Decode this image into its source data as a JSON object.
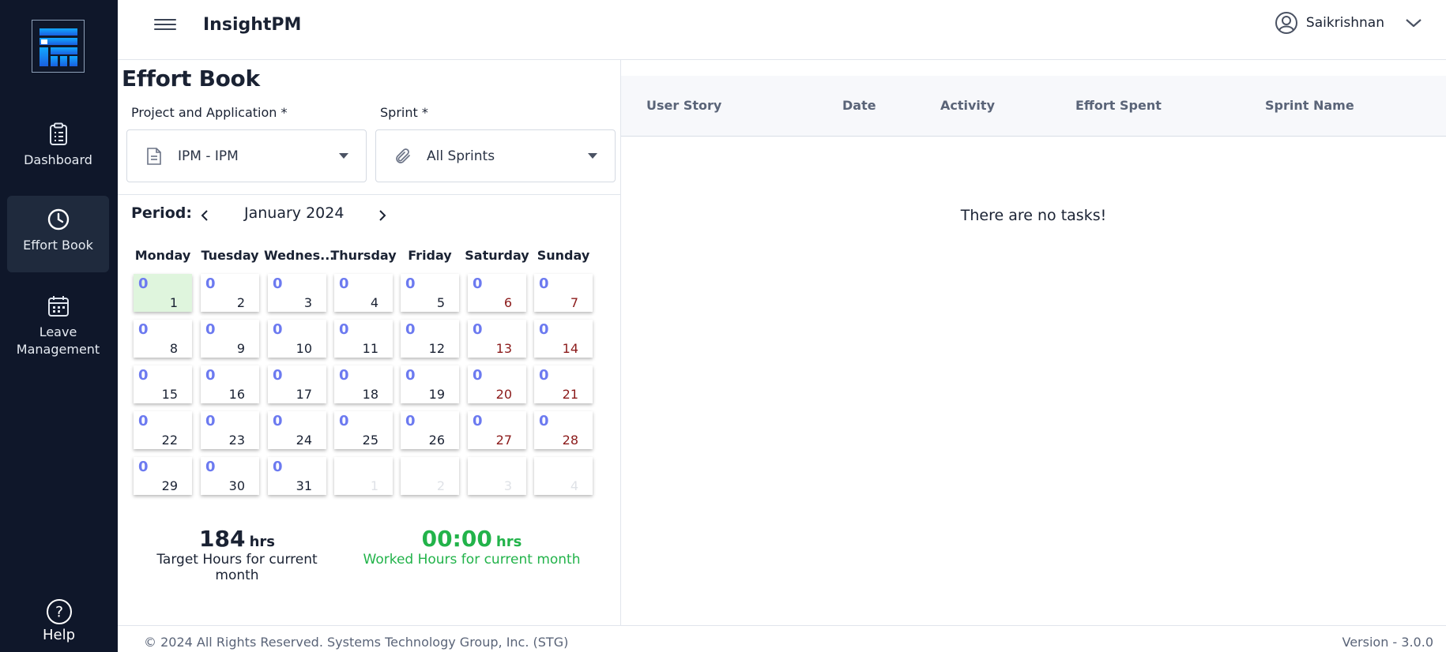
{
  "app": {
    "title": "InsightPM"
  },
  "user": {
    "name": "Saikrishnan"
  },
  "sidebar": {
    "items": [
      {
        "label": "Dashboard",
        "icon": "clipboard-icon"
      },
      {
        "label": "Effort Book",
        "icon": "clock-icon",
        "active": true
      },
      {
        "label": "Leave Management",
        "icon": "calendar-icon"
      }
    ],
    "help_label": "Help"
  },
  "effort_book": {
    "title": "Effort Book",
    "project": {
      "label": "Project and Application *",
      "value": "IPM - IPM"
    },
    "sprint": {
      "label": "Sprint *",
      "value": "All Sprints"
    },
    "period": {
      "label": "Period:",
      "month": "January 2024"
    },
    "weekdays": [
      "Monday",
      "Tuesday",
      "Wednes...",
      "Thursday",
      "Friday",
      "Saturday",
      "Sunday"
    ],
    "days": [
      {
        "hours": "0",
        "day": "1"
      },
      {
        "hours": "0",
        "day": "2"
      },
      {
        "hours": "0",
        "day": "3"
      },
      {
        "hours": "0",
        "day": "4"
      },
      {
        "hours": "0",
        "day": "5"
      },
      {
        "hours": "0",
        "day": "6"
      },
      {
        "hours": "0",
        "day": "7"
      },
      {
        "hours": "0",
        "day": "8"
      },
      {
        "hours": "0",
        "day": "9"
      },
      {
        "hours": "0",
        "day": "10"
      },
      {
        "hours": "0",
        "day": "11"
      },
      {
        "hours": "0",
        "day": "12"
      },
      {
        "hours": "0",
        "day": "13"
      },
      {
        "hours": "0",
        "day": "14"
      },
      {
        "hours": "0",
        "day": "15"
      },
      {
        "hours": "0",
        "day": "16"
      },
      {
        "hours": "0",
        "day": "17"
      },
      {
        "hours": "0",
        "day": "18"
      },
      {
        "hours": "0",
        "day": "19"
      },
      {
        "hours": "0",
        "day": "20"
      },
      {
        "hours": "0",
        "day": "21"
      },
      {
        "hours": "0",
        "day": "22"
      },
      {
        "hours": "0",
        "day": "23"
      },
      {
        "hours": "0",
        "day": "24"
      },
      {
        "hours": "0",
        "day": "25"
      },
      {
        "hours": "0",
        "day": "26"
      },
      {
        "hours": "0",
        "day": "27"
      },
      {
        "hours": "0",
        "day": "28"
      },
      {
        "hours": "0",
        "day": "29"
      },
      {
        "hours": "0",
        "day": "30"
      },
      {
        "hours": "0",
        "day": "31"
      },
      {
        "hours": "",
        "day": "1"
      },
      {
        "hours": "",
        "day": "2"
      },
      {
        "hours": "",
        "day": "3"
      },
      {
        "hours": "",
        "day": "4"
      }
    ],
    "target": {
      "value": "184",
      "unit": "hrs",
      "label": "Target Hours for current month"
    },
    "worked": {
      "value": "00:00",
      "unit": "hrs",
      "label": "Worked Hours for current month"
    }
  },
  "tasks_table": {
    "columns": [
      "User Story",
      "Date",
      "Activity",
      "Effort Spent",
      "Sprint Name"
    ],
    "empty_message": "There are no tasks!"
  },
  "footer": {
    "copyright": "© 2024 All Rights Reserved. Systems Technology Group, Inc. (STG)",
    "version": "Version - 3.0.0"
  },
  "colors": {
    "sidebar_bg": "#0f172a",
    "hours": "#6c7af0",
    "weekend": "#8b1a1a",
    "worked": "#22b34a",
    "today": "#dff5dd"
  }
}
